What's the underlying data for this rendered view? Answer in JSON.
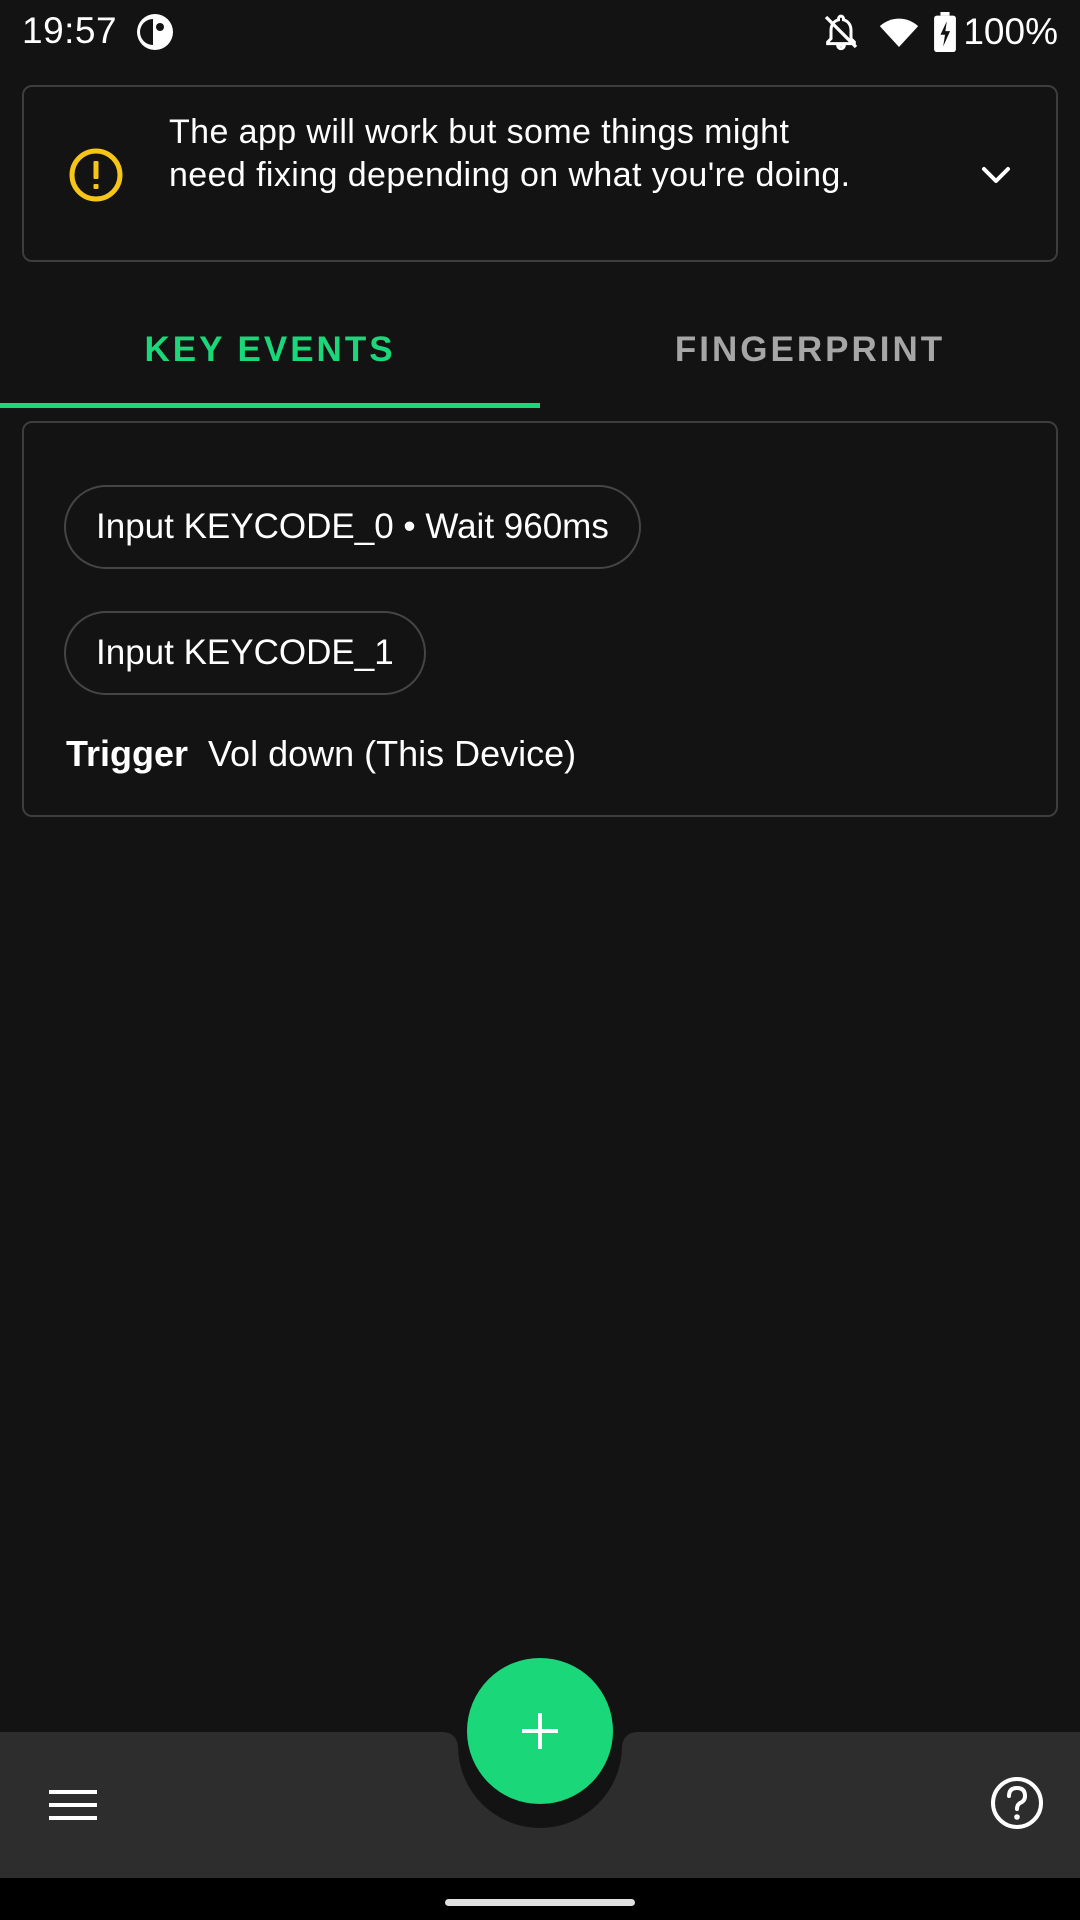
{
  "status_bar": {
    "time": "19:57",
    "app_icon": "app-logo-icon",
    "icons": [
      "notifications-off-icon",
      "wifi-icon",
      "battery-charging-icon"
    ],
    "battery_percent": "100%"
  },
  "warning": {
    "icon": "warning-icon",
    "text": "The app will work but some things might need fixing depending on what you're doing.",
    "expand_icon": "chevron-down-icon",
    "color": "#f5c518"
  },
  "tabs": [
    {
      "label": "KEY EVENTS",
      "selected": true
    },
    {
      "label": "FINGERPRINT",
      "selected": false
    }
  ],
  "mapping": {
    "actions": [
      {
        "label": "Input KEYCODE_0 • Wait 960ms"
      },
      {
        "label": "Input KEYCODE_1"
      }
    ],
    "trigger_label": "Trigger",
    "trigger_value": "Vol down (This Device)"
  },
  "bottom_bar": {
    "menu_icon": "menu-icon",
    "fab_icon": "add-icon",
    "help_icon": "help-icon"
  },
  "colors": {
    "accent": "#1ad87a",
    "background": "#131313",
    "surface": "#2d2d2d"
  }
}
